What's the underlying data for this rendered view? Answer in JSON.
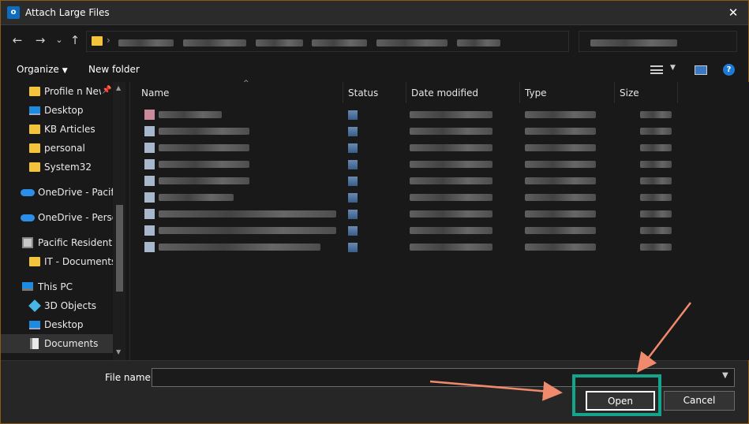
{
  "window": {
    "title": "Attach Large Files",
    "close_glyph": "✕"
  },
  "nav": {
    "back_glyph": "←",
    "forward_glyph": "→",
    "recent_glyph": "⌄",
    "up_glyph": "↑",
    "breadcrumb_separator": "›"
  },
  "toolbar": {
    "organize_label": "Organize",
    "new_folder_label": "New folder",
    "help_glyph": "?"
  },
  "sidebar": {
    "items": [
      {
        "label": "Profile n New",
        "icon": "folder-icon",
        "pinned": true
      },
      {
        "label": "Desktop",
        "icon": "desktop-icon"
      },
      {
        "label": "KB Articles",
        "icon": "folder-icon"
      },
      {
        "label": "personal",
        "icon": "folder-icon"
      },
      {
        "label": "System32",
        "icon": "folder-icon"
      },
      {
        "label": "OneDrive - Pacific",
        "icon": "cloud-icon"
      },
      {
        "label": "OneDrive - Person",
        "icon": "cloud-icon"
      },
      {
        "label": "Pacific Residential",
        "icon": "building-icon"
      },
      {
        "label": "IT - Documents",
        "icon": "folder-icon"
      },
      {
        "label": "This PC",
        "icon": "pc-icon"
      },
      {
        "label": "3D Objects",
        "icon": "3d-objects-icon"
      },
      {
        "label": "Desktop",
        "icon": "desktop-icon"
      },
      {
        "label": "Documents",
        "icon": "document-icon",
        "selected": true
      }
    ]
  },
  "filelist": {
    "columns": [
      "Name",
      "Status",
      "Date modified",
      "Type",
      "Size"
    ],
    "row_count": 9
  },
  "bottom": {
    "file_name_label": "File name:",
    "file_name_value": "",
    "open_label": "Open",
    "cancel_label": "Cancel"
  },
  "colors": {
    "annotation_highlight": "#14a38b",
    "annotation_arrow": "#f08a6c",
    "folder": "#f3c33c",
    "accent": "#1f7ad6"
  }
}
